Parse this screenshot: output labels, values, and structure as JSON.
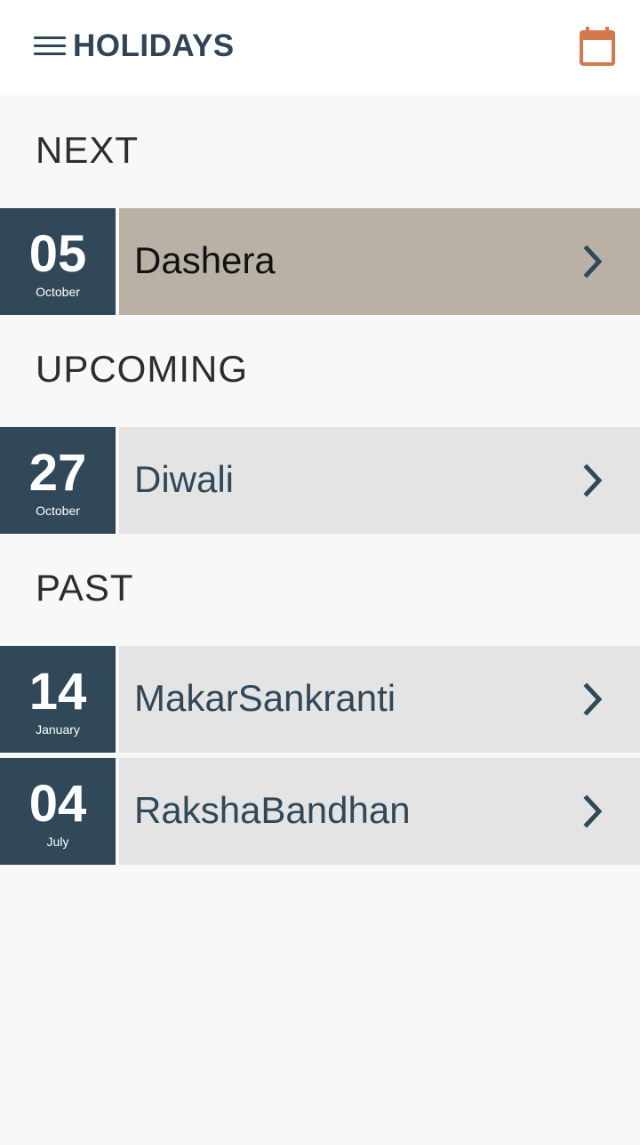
{
  "app_bar": {
    "title": "HOLIDAYS",
    "menu_icon": "hamburger-menu-icon",
    "calendar_icon": "calendar-icon",
    "accent_color": "#d4774f",
    "text_color": "#2f4456"
  },
  "sections": {
    "next": {
      "title": "NEXT",
      "items": [
        {
          "day": "05",
          "month": "October",
          "name": "Dashera"
        }
      ]
    },
    "upcoming": {
      "title": "UPCOMING",
      "items": [
        {
          "day": "27",
          "month": "October",
          "name": "Diwali"
        }
      ]
    },
    "past": {
      "title": "PAST",
      "items": [
        {
          "day": "14",
          "month": "January",
          "name": "MakarSankranti"
        },
        {
          "day": "04",
          "month": "July",
          "name": "RakshaBandhan"
        }
      ]
    }
  },
  "colors": {
    "date_box": "#314858",
    "next_highlight": "#b9b1a5",
    "row_background": "#e4e4e4",
    "page_background": "#f8f8f8"
  }
}
